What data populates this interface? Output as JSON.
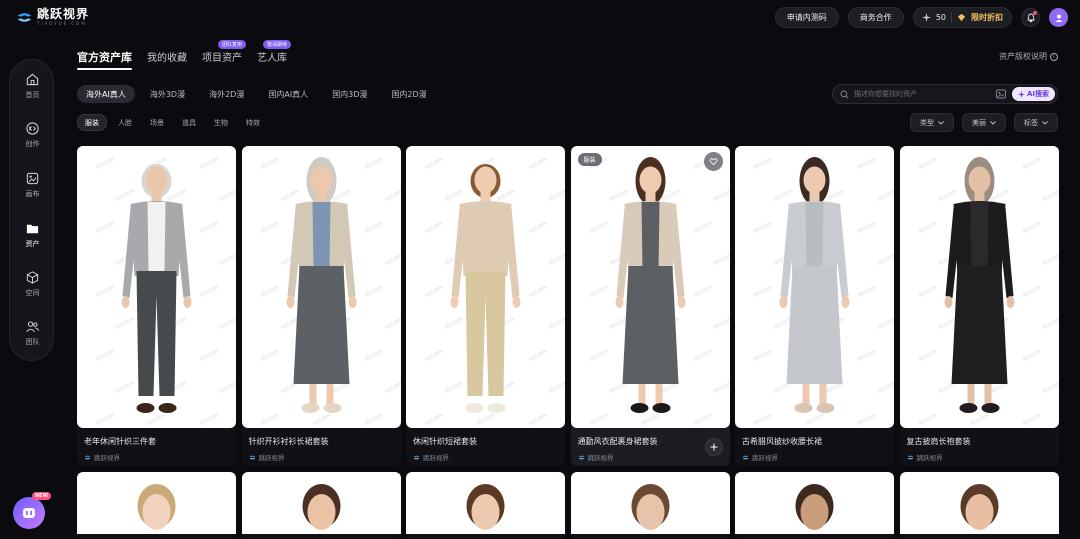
{
  "brand": {
    "name": "跳跃视界",
    "sub": "TIAOYUE.COM"
  },
  "topbar": {
    "apply_code": "申请内测码",
    "business": "商务合作",
    "credits": "50",
    "promo": "限时折扣"
  },
  "sidebar": {
    "items": [
      {
        "label": "首页",
        "icon": "home-icon",
        "active": false
      },
      {
        "label": "创作",
        "icon": "create-icon",
        "active": false
      },
      {
        "label": "画布",
        "icon": "canvas-icon",
        "active": false
      },
      {
        "label": "资产",
        "icon": "folder-icon",
        "active": true
      },
      {
        "label": "空间",
        "icon": "cube-icon",
        "active": false
      },
      {
        "label": "团队",
        "icon": "team-icon",
        "active": false
      }
    ],
    "assistant_badge": "NEW"
  },
  "tabs": [
    {
      "label": "官方资产库",
      "active": true,
      "badge": ""
    },
    {
      "label": "我的收藏",
      "active": false,
      "badge": ""
    },
    {
      "label": "项目资产",
      "active": false,
      "badge": "团队复用"
    },
    {
      "label": "艺人库",
      "active": false,
      "badge": "敬请期待"
    }
  ],
  "copyright_note": "资产版权说明",
  "categories": [
    {
      "label": "海外AI真人",
      "active": true
    },
    {
      "label": "海外3D漫",
      "active": false
    },
    {
      "label": "海外2D漫",
      "active": false
    },
    {
      "label": "国内AI真人",
      "active": false
    },
    {
      "label": "国内3D漫",
      "active": false
    },
    {
      "label": "国内2D漫",
      "active": false
    }
  ],
  "search": {
    "placeholder": "描述你想要找的资产",
    "ai_button": "AI搜索"
  },
  "subfilters": [
    {
      "label": "服装",
      "active": true
    },
    {
      "label": "人脸",
      "active": false
    },
    {
      "label": "场景",
      "active": false
    },
    {
      "label": "道具",
      "active": false
    },
    {
      "label": "生物",
      "active": false
    },
    {
      "label": "特效",
      "active": false
    }
  ],
  "dropdowns": [
    "类型",
    "美丽",
    "标签"
  ],
  "cards": [
    {
      "title": "老年休闲针织三件套",
      "brand": "跳跃视界",
      "hover": false,
      "figure": {
        "hair": "#d9d6d0",
        "skin": "#e8c7ad",
        "top": "#a7a9ac",
        "inner": "#f1f1f1",
        "bottom": "#454a4d",
        "shoe": "#3a2518",
        "dress": false
      }
    },
    {
      "title": "针织开衫衬衫长裙套装",
      "brand": "跳跃视界",
      "hover": false,
      "figure": {
        "hair": "#cfcac2",
        "skin": "#ecc8ad",
        "top": "#d3c7b6",
        "inner": "#7d95b3",
        "bottom": "#5c6166",
        "shoe": "#e5d5c4",
        "dress": true
      }
    },
    {
      "title": "休闲针织短裙套装",
      "brand": "跳跃视界",
      "hover": false,
      "figure": {
        "hair": "#8a5a33",
        "skin": "#f0cdb1",
        "top": "#dfcab4",
        "inner": "#dfcab4",
        "bottom": "#d9c79f",
        "shoe": "#efe8dc",
        "dress": false
      }
    },
    {
      "title": "通勤风衣配裹身裙套装",
      "brand": "跳跃视界",
      "hover": true,
      "tag": "服装",
      "figure": {
        "hair": "#4a2f22",
        "skin": "#eccbb1",
        "top": "#d8cbb9",
        "inner": "#5d6062",
        "bottom": "#5d6062",
        "shoe": "#1a1a1a",
        "dress": true
      }
    },
    {
      "title": "古希腊风披纱收腰长裙",
      "brand": "跳跃视界",
      "hover": false,
      "figure": {
        "hair": "#3a2a22",
        "skin": "#ecc9b0",
        "top": "#c9cdd1",
        "inner": "#b8bdc2",
        "bottom": "#c4c8cc",
        "shoe": "#d9c6b2",
        "dress": true
      }
    },
    {
      "title": "复古披肩长袍套装",
      "brand": "跳跃视界",
      "hover": false,
      "figure": {
        "hair": "#9a8c7e",
        "skin": "#e3c0a6",
        "top": "#1c1c1e",
        "inner": "#2a2a2d",
        "bottom": "#1f1f22",
        "shoe": "#241a22",
        "dress": true
      }
    }
  ],
  "second_row": [
    {
      "hair": "#c9a978",
      "skin": "#f1d3bd"
    },
    {
      "hair": "#4a3024",
      "skin": "#e9c3a3"
    },
    {
      "hair": "#5b3a25",
      "skin": "#eccaaf"
    },
    {
      "hair": "#6b4a33",
      "skin": "#e7c4a9"
    },
    {
      "hair": "#3c2a20",
      "skin": "#c99c7a"
    },
    {
      "hair": "#5a3b28",
      "skin": "#e8bfa2"
    }
  ],
  "watermark": "跳跃视界",
  "colors": {
    "accent": "#7d5cf0",
    "promo": "#f2c25b",
    "bg": "#0b0b0f"
  }
}
